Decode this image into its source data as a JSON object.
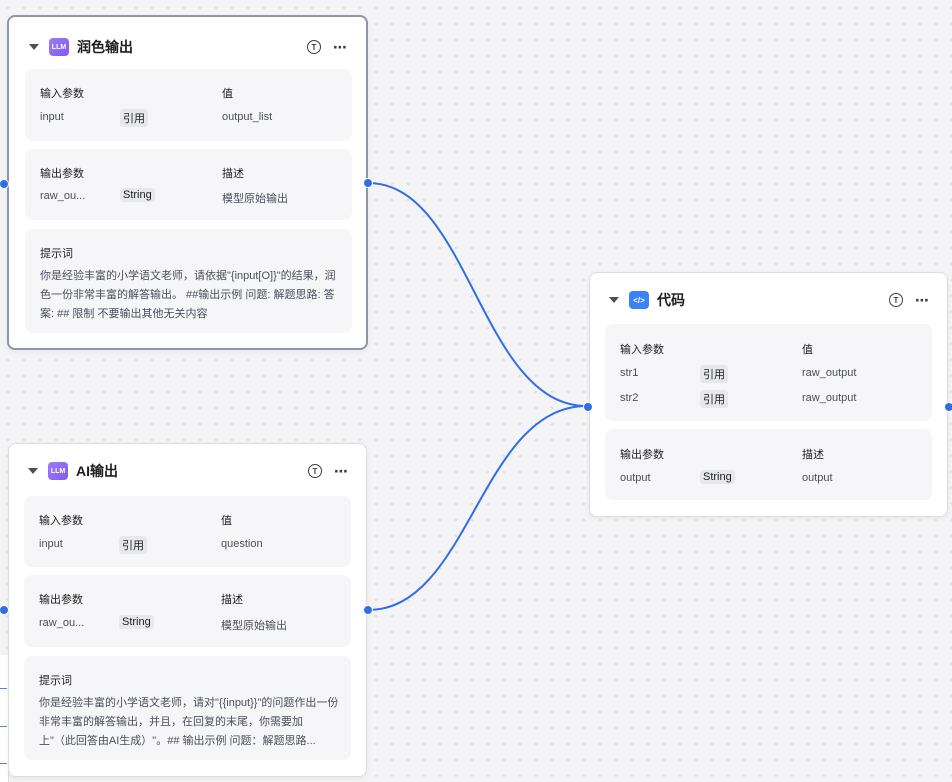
{
  "nodes": {
    "polish": {
      "icon": "llm-icon",
      "icon_text": "LLM",
      "title": "润色输出",
      "input_section": {
        "col1": "输入参数",
        "col2": "值",
        "rows": [
          {
            "name": "input",
            "type": "引用",
            "value": "output_list"
          }
        ]
      },
      "output_section": {
        "col1": "输出参数",
        "col2": "描述",
        "rows": [
          {
            "name": "raw_ou...",
            "type": "String",
            "value": "模型原始输出"
          }
        ]
      },
      "prompt": {
        "label": "提示词",
        "text": "你是经验丰富的小学语文老师，请依据\"{input[O]}\"的结果，润色一份非常丰富的解答输出。 ##输出示例 问题: 解题思路: 答案: ## 限制 不要输出其他无关内容"
      }
    },
    "ai": {
      "icon": "llm-icon",
      "icon_text": "LLM",
      "title": "AI输出",
      "input_section": {
        "col1": "输入参数",
        "col2": "值",
        "rows": [
          {
            "name": "input",
            "type": "引用",
            "value": "question"
          }
        ]
      },
      "output_section": {
        "col1": "输出参数",
        "col2": "描述",
        "rows": [
          {
            "name": "raw_ou...",
            "type": "String",
            "value": "模型原始输出"
          }
        ]
      },
      "prompt": {
        "label": "提示词",
        "text": "你是经验丰富的小学语文老师，请对\"{{input}}\"的问题作出一份非常丰富的解答输出，并且，在回复的末尾，你需要加上\"（此回答由AI生成）\"。## 输出示例 问题：解题思路..."
      }
    },
    "code": {
      "icon": "code-icon",
      "icon_text": "</>",
      "title": "代码",
      "input_section": {
        "col1": "输入参数",
        "col2": "值",
        "rows": [
          {
            "name": "str1",
            "type": "引用",
            "value": "raw_output"
          },
          {
            "name": "str2",
            "type": "引用",
            "value": "raw_output"
          }
        ]
      },
      "output_section": {
        "col1": "输出参数",
        "col2": "描述",
        "rows": [
          {
            "name": "output",
            "type": "String",
            "value": "output"
          }
        ]
      }
    }
  },
  "header_actions": {
    "test_icon": "T",
    "more_icon": "⋯"
  },
  "colors": {
    "edge": "#2f6fe4",
    "port": "#2f6fe4"
  }
}
